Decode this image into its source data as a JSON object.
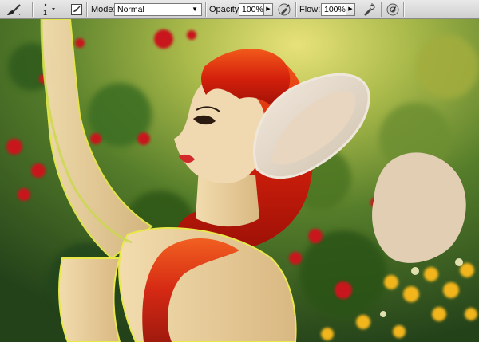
{
  "toolbar": {
    "brush_size": "1",
    "mode_label": "Mode:",
    "mode_value": "Normal",
    "opacity_label": "Opacity:",
    "opacity_value": "100%",
    "flow_label": "Flow:",
    "flow_value": "100%"
  },
  "icons": {
    "brush_tool": "brush-icon",
    "brush_preset": "brush-preset-icon",
    "brush_panel": "brush-panel-toggle-icon",
    "airbrush": "airbrush-icon",
    "tablet_opacity": "tablet-pressure-opacity-icon",
    "tablet_size": "tablet-pressure-size-icon"
  },
  "colors": {
    "toolbar_bg": "#d8d8d8",
    "hair": "#d0200f",
    "skin": "#ecd5a8",
    "beige_blob": "#e2cfb3",
    "background_green": "#3f6b1f"
  }
}
